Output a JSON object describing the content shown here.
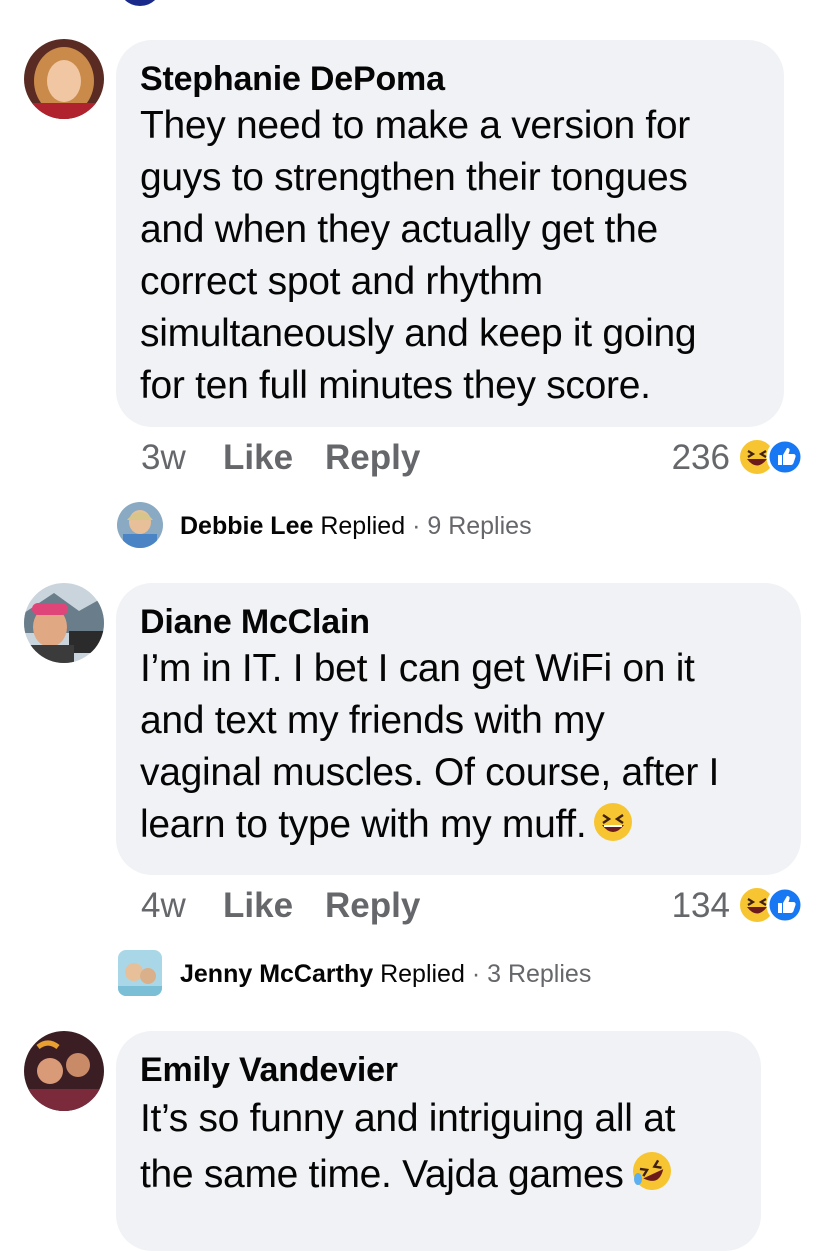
{
  "comments": [
    {
      "author": "Stephanie DePoma",
      "lines": [
        "They need to make a version for",
        "guys to strengthen their tongues",
        "and when they actually get the",
        "correct spot and rhythm",
        "simultaneously and keep it going",
        "for ten full minutes they score."
      ],
      "time": "3w",
      "like_label": "Like",
      "reply_label": "Reply",
      "reaction_count": "236",
      "reactions": [
        "haha-icon",
        "like-icon"
      ],
      "replies": {
        "name": "Debbie Lee",
        "action": "Replied",
        "separator": "·",
        "count": "9 Replies"
      }
    },
    {
      "author": "Diane McClain",
      "lines": [
        "I’m in IT. I bet I can get WiFi on it",
        "and text my friends with my",
        "vaginal muscles. Of course, after I",
        "learn to type with my muff."
      ],
      "trailing_emoji": "laughing-emoji",
      "time": "4w",
      "like_label": "Like",
      "reply_label": "Reply",
      "reaction_count": "134",
      "reactions": [
        "haha-icon",
        "like-icon"
      ],
      "replies": {
        "name": "Jenny McCarthy",
        "action": "Replied",
        "separator": "·",
        "count": "3 Replies"
      }
    },
    {
      "author": "Emily Vandevier",
      "lines": [
        "It’s so funny and intriguing all at",
        "the same time. Vajda games"
      ],
      "trailing_emoji": "rofl-emoji"
    }
  ],
  "colors": {
    "bubble": "#f0f2f5",
    "text": "#050505",
    "muted": "#65676b",
    "like_blue": "#1877f2",
    "haha_yellow": "#f7c531"
  }
}
